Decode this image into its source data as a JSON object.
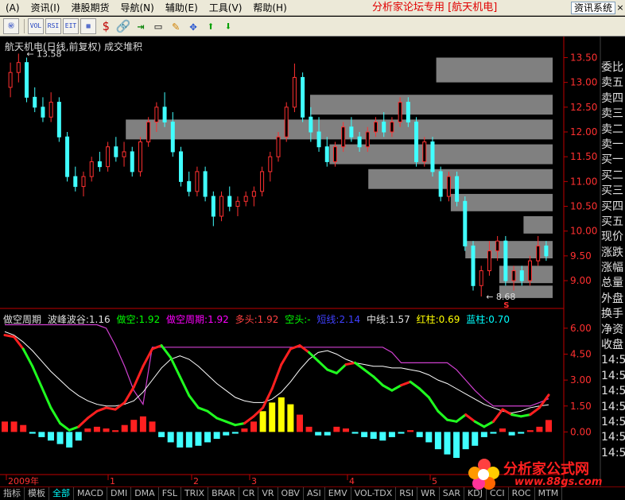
{
  "menu": {
    "items": [
      "(A)",
      "资讯(I)",
      "港股期货",
      "导航(N)",
      "辅助(E)",
      "工具(V)",
      "帮助(H)"
    ],
    "forum_title": "分析家论坛专用 [航天机电]",
    "info_button": "资讯系统",
    "close_label": "×"
  },
  "toolbar": {
    "buttons": [
      "㊙",
      "VOL",
      "RSI",
      "EIT",
      "▦",
      "$",
      "🔗",
      "⇥",
      "▭",
      "✎",
      "✥",
      "⬆",
      "⬇"
    ]
  },
  "panel": {
    "title": "航天机电(日线,前复权) 成交堆积",
    "high_label": "13.58",
    "low_label": "8.68",
    "s_label": "S"
  },
  "indicator": {
    "name": "做空周期",
    "fields": [
      {
        "label": "波峰波谷:1.16",
        "color": "#e0e0e0"
      },
      {
        "label": "做空:1.92",
        "color": "#00ff00"
      },
      {
        "label": "做空周期:1.92",
        "color": "#ff00ff"
      },
      {
        "label": "多头:1.92",
        "color": "#ff4040"
      },
      {
        "label": "空头:-",
        "color": "#00ff00"
      },
      {
        "label": "短线:2.14",
        "color": "#4040ff"
      },
      {
        "label": "中线:1.57",
        "color": "#e0e0e0"
      },
      {
        "label": "红柱:0.69",
        "color": "#ffff00"
      },
      {
        "label": "蓝柱:0.70",
        "color": "#00ffff"
      }
    ]
  },
  "price_axis": [
    "13.50",
    "13.00",
    "12.50",
    "12.00",
    "11.50",
    "11.00",
    "10.50",
    "10.00",
    "9.50",
    "9.00"
  ],
  "ind_axis": [
    "6.00",
    "4.50",
    "3.00",
    "1.50",
    "0.00"
  ],
  "side_list": [
    "委比",
    "卖五",
    "卖四",
    "卖三",
    "卖二",
    "卖一",
    "买一",
    "买二",
    "买三",
    "买四",
    "买五",
    "现价",
    "涨跌",
    "涨幅",
    "总量",
    "外盘",
    "换手",
    "净资",
    "收盘",
    "14:5",
    "14:5",
    "14:5",
    "14:5",
    "14:5",
    "14:5",
    "14:5"
  ],
  "time_axis": [
    "2009年",
    "1",
    "2",
    "3",
    "4",
    "5"
  ],
  "tabs": [
    "指标",
    "模板",
    "全部",
    "MACD",
    "DMI",
    "DMA",
    "FSL",
    "TRIX",
    "BRAR",
    "CR",
    "VR",
    "OBV",
    "ASI",
    "EMV",
    "VOL-TDX",
    "RSI",
    "WR",
    "SAR",
    "KDJ",
    "CCI",
    "ROC",
    "MTM"
  ],
  "watermark": {
    "text": "分析家公式网",
    "url": "www.88gs.com"
  },
  "colors": {
    "up": "#ff3030",
    "down": "#40ffff",
    "axis": "#c00000",
    "volume_zone": "#808080"
  },
  "chart_data": {
    "type": "candlestick",
    "price_range": [
      8.6,
      13.7
    ],
    "candles": [
      {
        "o": 12.9,
        "h": 13.4,
        "l": 12.7,
        "c": 13.2
      },
      {
        "o": 13.2,
        "h": 13.58,
        "l": 13.0,
        "c": 13.4
      },
      {
        "o": 13.4,
        "h": 13.5,
        "l": 12.6,
        "c": 12.7
      },
      {
        "o": 12.7,
        "h": 12.9,
        "l": 12.4,
        "c": 12.5
      },
      {
        "o": 12.5,
        "h": 12.7,
        "l": 12.2,
        "c": 12.3
      },
      {
        "o": 12.3,
        "h": 12.8,
        "l": 12.2,
        "c": 12.6
      },
      {
        "o": 12.6,
        "h": 12.7,
        "l": 11.8,
        "c": 11.9
      },
      {
        "o": 11.9,
        "h": 12.0,
        "l": 11.0,
        "c": 11.1
      },
      {
        "o": 11.1,
        "h": 11.3,
        "l": 10.8,
        "c": 10.9
      },
      {
        "o": 10.9,
        "h": 11.2,
        "l": 10.7,
        "c": 11.1
      },
      {
        "o": 11.1,
        "h": 11.5,
        "l": 11.0,
        "c": 11.4
      },
      {
        "o": 11.4,
        "h": 11.6,
        "l": 11.2,
        "c": 11.3
      },
      {
        "o": 11.3,
        "h": 11.8,
        "l": 11.2,
        "c": 11.7
      },
      {
        "o": 11.7,
        "h": 11.9,
        "l": 11.4,
        "c": 11.5
      },
      {
        "o": 11.5,
        "h": 11.8,
        "l": 11.3,
        "c": 11.6
      },
      {
        "o": 11.6,
        "h": 11.7,
        "l": 11.1,
        "c": 11.2
      },
      {
        "o": 11.2,
        "h": 11.9,
        "l": 11.1,
        "c": 11.8
      },
      {
        "o": 11.8,
        "h": 12.3,
        "l": 11.7,
        "c": 12.2
      },
      {
        "o": 12.2,
        "h": 12.6,
        "l": 12.0,
        "c": 12.5
      },
      {
        "o": 12.5,
        "h": 12.8,
        "l": 12.1,
        "c": 12.2
      },
      {
        "o": 12.2,
        "h": 12.4,
        "l": 11.5,
        "c": 11.6
      },
      {
        "o": 11.6,
        "h": 11.7,
        "l": 10.9,
        "c": 11.0
      },
      {
        "o": 11.0,
        "h": 11.2,
        "l": 10.7,
        "c": 10.8
      },
      {
        "o": 10.8,
        "h": 11.3,
        "l": 10.7,
        "c": 11.2
      },
      {
        "o": 11.2,
        "h": 11.3,
        "l": 10.6,
        "c": 10.7
      },
      {
        "o": 10.7,
        "h": 10.8,
        "l": 10.1,
        "c": 10.3
      },
      {
        "o": 10.3,
        "h": 10.8,
        "l": 10.2,
        "c": 10.7
      },
      {
        "o": 10.7,
        "h": 10.9,
        "l": 10.4,
        "c": 10.5
      },
      {
        "o": 10.5,
        "h": 10.7,
        "l": 10.3,
        "c": 10.6
      },
      {
        "o": 10.6,
        "h": 10.8,
        "l": 10.5,
        "c": 10.7
      },
      {
        "o": 10.7,
        "h": 10.9,
        "l": 10.5,
        "c": 10.8
      },
      {
        "o": 10.8,
        "h": 11.3,
        "l": 10.7,
        "c": 11.2
      },
      {
        "o": 11.2,
        "h": 11.6,
        "l": 11.0,
        "c": 11.5
      },
      {
        "o": 11.5,
        "h": 12.0,
        "l": 11.4,
        "c": 11.9
      },
      {
        "o": 11.9,
        "h": 12.6,
        "l": 11.8,
        "c": 12.5
      },
      {
        "o": 12.5,
        "h": 13.38,
        "l": 12.4,
        "c": 13.1
      },
      {
        "o": 13.1,
        "h": 13.2,
        "l": 12.2,
        "c": 12.3
      },
      {
        "o": 12.3,
        "h": 12.5,
        "l": 11.8,
        "c": 12.0
      },
      {
        "o": 12.0,
        "h": 12.3,
        "l": 11.6,
        "c": 11.7
      },
      {
        "o": 11.7,
        "h": 11.9,
        "l": 11.3,
        "c": 11.4
      },
      {
        "o": 11.4,
        "h": 11.8,
        "l": 11.3,
        "c": 11.7
      },
      {
        "o": 11.7,
        "h": 12.2,
        "l": 11.6,
        "c": 12.1
      },
      {
        "o": 12.1,
        "h": 12.3,
        "l": 11.8,
        "c": 11.9
      },
      {
        "o": 11.9,
        "h": 12.0,
        "l": 11.6,
        "c": 11.7
      },
      {
        "o": 11.7,
        "h": 12.1,
        "l": 11.6,
        "c": 12.0
      },
      {
        "o": 12.0,
        "h": 12.3,
        "l": 11.9,
        "c": 12.2
      },
      {
        "o": 12.2,
        "h": 12.4,
        "l": 11.9,
        "c": 12.0
      },
      {
        "o": 12.0,
        "h": 12.3,
        "l": 11.9,
        "c": 12.2
      },
      {
        "o": 12.2,
        "h": 12.7,
        "l": 12.1,
        "c": 12.6
      },
      {
        "o": 12.6,
        "h": 12.7,
        "l": 12.1,
        "c": 12.2
      },
      {
        "o": 12.2,
        "h": 12.3,
        "l": 11.3,
        "c": 11.4
      },
      {
        "o": 11.4,
        "h": 11.9,
        "l": 11.3,
        "c": 11.8
      },
      {
        "o": 11.8,
        "h": 11.9,
        "l": 11.1,
        "c": 11.2
      },
      {
        "o": 11.2,
        "h": 11.3,
        "l": 10.6,
        "c": 10.7
      },
      {
        "o": 10.7,
        "h": 11.2,
        "l": 10.6,
        "c": 11.1
      },
      {
        "o": 11.1,
        "h": 11.2,
        "l": 10.5,
        "c": 10.6
      },
      {
        "o": 10.6,
        "h": 10.7,
        "l": 9.6,
        "c": 9.7
      },
      {
        "o": 9.7,
        "h": 9.8,
        "l": 8.8,
        "c": 8.9
      },
      {
        "o": 8.9,
        "h": 9.3,
        "l": 8.68,
        "c": 9.2
      },
      {
        "o": 9.2,
        "h": 9.8,
        "l": 9.1,
        "c": 9.6
      },
      {
        "o": 9.6,
        "h": 9.9,
        "l": 9.4,
        "c": 9.8
      },
      {
        "o": 9.8,
        "h": 9.9,
        "l": 8.9,
        "c": 9.0
      },
      {
        "o": 9.0,
        "h": 9.3,
        "l": 8.8,
        "c": 9.2
      },
      {
        "o": 9.2,
        "h": 9.3,
        "l": 8.9,
        "c": 9.0
      },
      {
        "o": 9.0,
        "h": 9.5,
        "l": 8.9,
        "c": 9.4
      },
      {
        "o": 9.4,
        "h": 9.9,
        "l": 9.3,
        "c": 9.7
      },
      {
        "o": 9.7,
        "h": 9.8,
        "l": 9.4,
        "c": 9.5
      }
    ],
    "volume_profile": [
      {
        "lo": 13.0,
        "hi": 13.5,
        "extent": 0.24
      },
      {
        "lo": 12.35,
        "hi": 12.75,
        "extent": 0.5
      },
      {
        "lo": 11.85,
        "hi": 12.25,
        "extent": 0.88
      },
      {
        "lo": 11.35,
        "hi": 11.75,
        "extent": 0.46
      },
      {
        "lo": 10.85,
        "hi": 11.25,
        "extent": 0.38
      },
      {
        "lo": 10.4,
        "hi": 10.75,
        "extent": 0.21
      },
      {
        "lo": 9.95,
        "hi": 10.3,
        "extent": 0.06
      },
      {
        "lo": 9.45,
        "hi": 9.8,
        "extent": 0.18
      },
      {
        "lo": 8.95,
        "hi": 9.3,
        "extent": 0.11
      },
      {
        "lo": 8.65,
        "hi": 8.9,
        "extent": 0.11
      }
    ],
    "indicator_range": [
      -1.5,
      6.5
    ],
    "ind_white": [
      5.8,
      5.6,
      5.2,
      4.7,
      4.1,
      3.5,
      3.0,
      2.5,
      2.1,
      1.8,
      1.6,
      1.5,
      1.5,
      1.6,
      1.8,
      2.3,
      3.0,
      3.7,
      4.2,
      4.4,
      4.2,
      3.8,
      3.3,
      2.8,
      2.4,
      2.0,
      1.8,
      1.7,
      1.7,
      1.9,
      2.3,
      2.9,
      3.6,
      4.2,
      4.6,
      4.7,
      4.5,
      4.2,
      4.0,
      3.9,
      3.8,
      3.8,
      3.7,
      3.7,
      3.6,
      3.5,
      3.3,
      3.0,
      2.8,
      2.5,
      2.2,
      1.9,
      1.6,
      1.4,
      1.2,
      1.1,
      1.2,
      1.4,
      1.5,
      1.57
    ],
    "ind_color_line": [
      5.6,
      5.5,
      4.8,
      3.8,
      2.6,
      1.4,
      0.5,
      0.1,
      0.3,
      0.8,
      1.2,
      1.4,
      1.3,
      1.7,
      2.6,
      3.8,
      4.8,
      5.0,
      4.3,
      3.2,
      2.1,
      1.4,
      1.2,
      0.8,
      0.6,
      0.4,
      0.5,
      0.9,
      1.4,
      2.5,
      3.9,
      4.8,
      5.0,
      4.6,
      4.1,
      3.6,
      3.4,
      3.9,
      4.0,
      3.6,
      3.2,
      2.7,
      2.4,
      2.7,
      2.9,
      2.5,
      2.0,
      1.2,
      0.7,
      0.6,
      1.0,
      0.6,
      0.3,
      0.6,
      1.3,
      1.0,
      0.9,
      1.0,
      1.4,
      2.14
    ],
    "ind_color_up": [
      1,
      1,
      0,
      0,
      0,
      0,
      0,
      0,
      1,
      1,
      1,
      1,
      1,
      1,
      1,
      1,
      1,
      0,
      0,
      0,
      0,
      0,
      0,
      0,
      0,
      0,
      1,
      1,
      1,
      1,
      1,
      1,
      1,
      0,
      0,
      0,
      0,
      1,
      0,
      0,
      0,
      0,
      0,
      1,
      0,
      0,
      0,
      0,
      0,
      0,
      1,
      0,
      0,
      1,
      1,
      0,
      0,
      1,
      1,
      1
    ],
    "ind_magenta": [
      6.2,
      6.2,
      6.2,
      6.2,
      6.2,
      6.2,
      6.2,
      6.2,
      6.2,
      6.2,
      6.2,
      6.0,
      5.0,
      3.8,
      2.4,
      1.6,
      4.9,
      4.9,
      4.9,
      4.9,
      4.9,
      4.9,
      4.9,
      4.9,
      4.9,
      4.9,
      4.9,
      4.9,
      4.9,
      4.9,
      4.9,
      4.9,
      4.9,
      4.9,
      4.9,
      4.9,
      4.9,
      4.9,
      4.9,
      4.9,
      4.9,
      4.9,
      4.6,
      4.0,
      4.0,
      4.0,
      4.0,
      4.0,
      4.0,
      3.6,
      3.0,
      2.4,
      1.9,
      1.5,
      1.5,
      1.5,
      1.5,
      1.5,
      1.7,
      1.92
    ],
    "ind_bars": [
      0.6,
      0.6,
      0.4,
      -0.1,
      -0.3,
      -0.5,
      -0.7,
      -0.9,
      -0.5,
      0.2,
      0.3,
      0.2,
      0.1,
      0.4,
      0.7,
      0.9,
      0.6,
      -0.3,
      -0.6,
      -0.9,
      -0.9,
      -0.8,
      -0.6,
      -0.4,
      -0.2,
      -0.1,
      0.2,
      0.6,
      1.2,
      1.7,
      2.0,
      1.6,
      1.0,
      0.3,
      -0.2,
      -0.2,
      0.3,
      0.2,
      -0.1,
      -0.3,
      -0.4,
      -0.5,
      -0.3,
      -0.1,
      0.1,
      -0.3,
      -0.6,
      -1.0,
      -1.3,
      -1.5,
      -1.0,
      -0.8,
      -0.3,
      -0.1,
      0.2,
      -0.2,
      -0.1,
      0.1,
      0.3,
      0.69
    ]
  }
}
